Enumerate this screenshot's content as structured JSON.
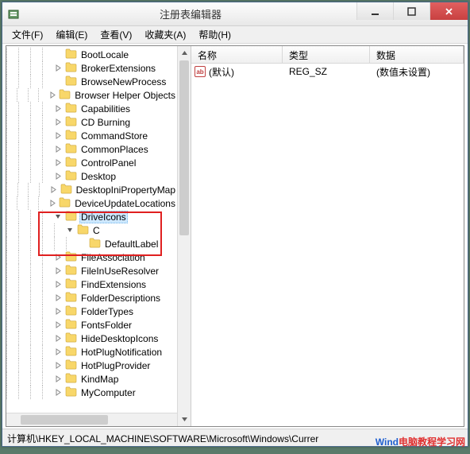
{
  "window": {
    "title": "注册表编辑器"
  },
  "menu": {
    "file": "文件(F)",
    "edit": "编辑(E)",
    "view": "查看(V)",
    "favorites": "收藏夹(A)",
    "help": "帮助(H)"
  },
  "list": {
    "headers": {
      "name": "名称",
      "type": "类型",
      "data": "数据"
    },
    "rows": [
      {
        "icon": "ab",
        "name": "(默认)",
        "type": "REG_SZ",
        "data": "(数值未设置)"
      }
    ]
  },
  "tree": {
    "selected": "DriveIcons",
    "nodes": [
      {
        "label": "BootLocale",
        "depth": 4,
        "children": false
      },
      {
        "label": "BrokerExtensions",
        "depth": 4,
        "children": true
      },
      {
        "label": "BrowseNewProcess",
        "depth": 4,
        "children": false
      },
      {
        "label": "Browser Helper Objects",
        "depth": 4,
        "children": true
      },
      {
        "label": "Capabilities",
        "depth": 4,
        "children": true
      },
      {
        "label": "CD Burning",
        "depth": 4,
        "children": true
      },
      {
        "label": "CommandStore",
        "depth": 4,
        "children": true
      },
      {
        "label": "CommonPlaces",
        "depth": 4,
        "children": true
      },
      {
        "label": "ControlPanel",
        "depth": 4,
        "children": true
      },
      {
        "label": "Desktop",
        "depth": 4,
        "children": true
      },
      {
        "label": "DesktopIniPropertyMap",
        "depth": 4,
        "children": true
      },
      {
        "label": "DeviceUpdateLocations",
        "depth": 4,
        "children": true
      },
      {
        "label": "DriveIcons",
        "depth": 4,
        "children": true,
        "expanded": true,
        "selected": true
      },
      {
        "label": "C",
        "depth": 5,
        "children": true,
        "expanded": true
      },
      {
        "label": "DefaultLabel",
        "depth": 6,
        "children": false
      },
      {
        "label": "FileAssociation",
        "depth": 4,
        "children": true
      },
      {
        "label": "FileInUseResolver",
        "depth": 4,
        "children": true
      },
      {
        "label": "FindExtensions",
        "depth": 4,
        "children": true
      },
      {
        "label": "FolderDescriptions",
        "depth": 4,
        "children": true
      },
      {
        "label": "FolderTypes",
        "depth": 4,
        "children": true
      },
      {
        "label": "FontsFolder",
        "depth": 4,
        "children": true
      },
      {
        "label": "HideDesktopIcons",
        "depth": 4,
        "children": true
      },
      {
        "label": "HotPlugNotification",
        "depth": 4,
        "children": true
      },
      {
        "label": "HotPlugProvider",
        "depth": 4,
        "children": true
      },
      {
        "label": "KindMap",
        "depth": 4,
        "children": true
      },
      {
        "label": "MyComputer",
        "depth": 4,
        "children": true
      }
    ]
  },
  "statusbar": {
    "path": "计算机\\HKEY_LOCAL_MACHINE\\SOFTWARE\\Microsoft\\Windows\\Currer"
  },
  "watermark": {
    "t1": "Wind",
    "t2": "电脑教程学习网"
  }
}
